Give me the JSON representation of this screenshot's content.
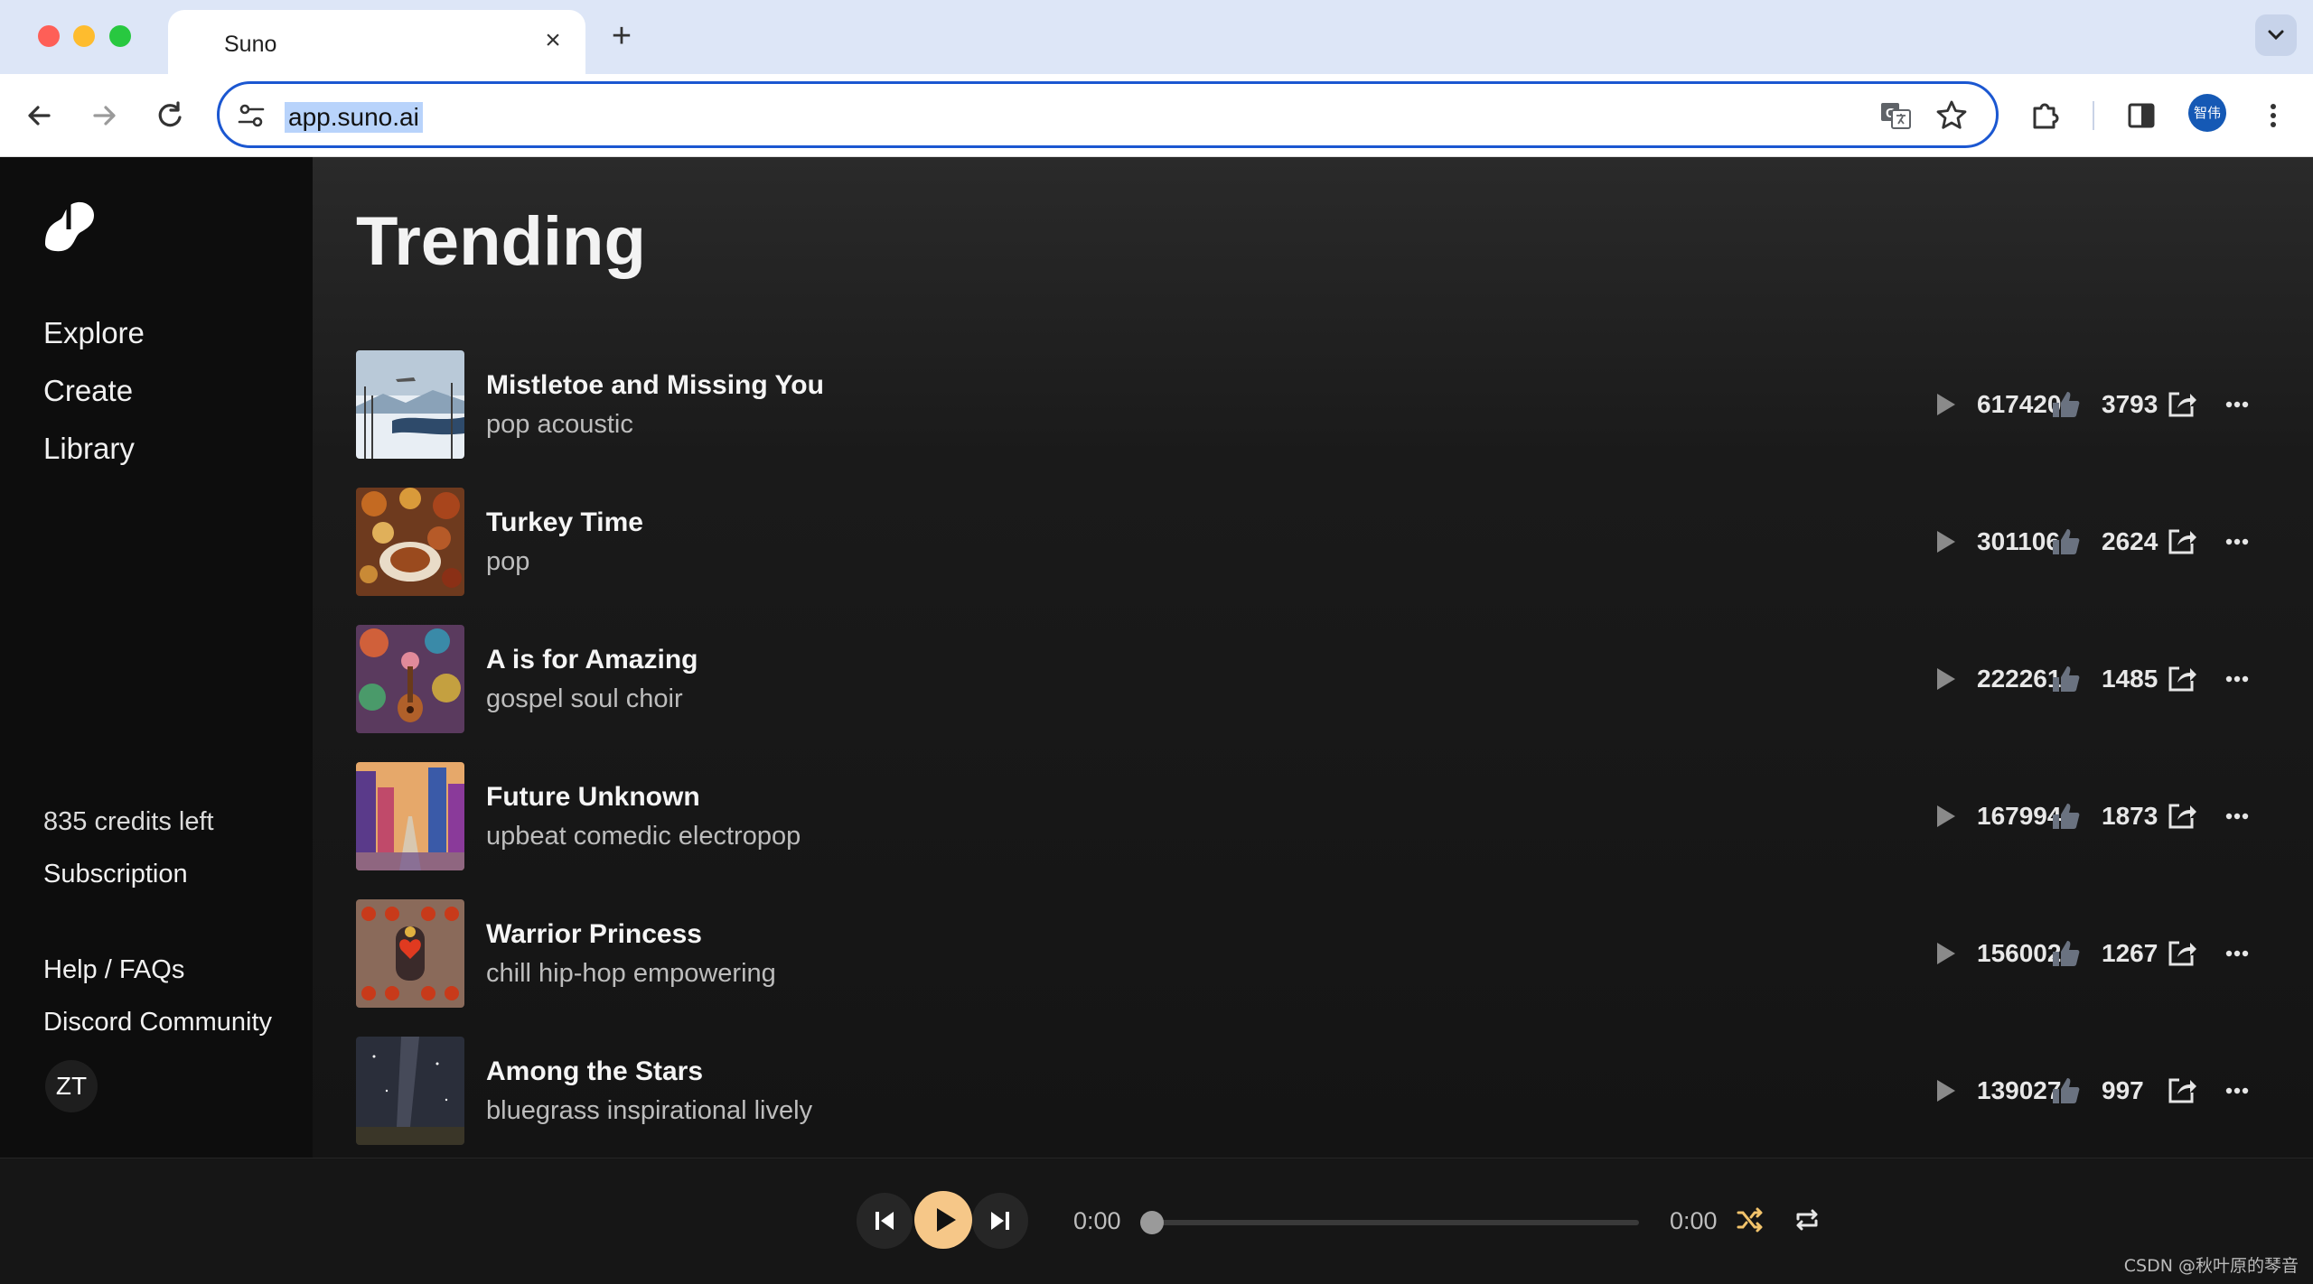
{
  "browser": {
    "tab_title": "Suno",
    "close_label": "×",
    "newtab_label": "+",
    "url": "app.suno.ai",
    "profile_initials": "智伟"
  },
  "sidebar": {
    "nav": [
      "Explore",
      "Create",
      "Library"
    ],
    "credits": "835 credits left",
    "subscription": "Subscription",
    "help": "Help / FAQs",
    "discord": "Discord Community",
    "user_initials": "ZT"
  },
  "main": {
    "title": "Trending",
    "songs": [
      {
        "title": "Mistletoe and Missing You",
        "genre": "pop acoustic",
        "plays": "617420",
        "likes": "3793"
      },
      {
        "title": "Turkey Time",
        "genre": "pop",
        "plays": "301106",
        "likes": "2624"
      },
      {
        "title": "A is for Amazing",
        "genre": "gospel soul choir",
        "plays": "222261",
        "likes": "1485"
      },
      {
        "title": "Future Unknown",
        "genre": "upbeat comedic electropop",
        "plays": "167994",
        "likes": "1873"
      },
      {
        "title": "Warrior Princess",
        "genre": "chill hip-hop empowering",
        "plays": "156002",
        "likes": "1267"
      },
      {
        "title": "Among the Stars",
        "genre": "bluegrass inspirational lively",
        "plays": "139027",
        "likes": "997"
      }
    ]
  },
  "player": {
    "current_time": "0:00",
    "duration": "0:00",
    "progress": 0
  },
  "watermark": "CSDN @秋叶原的琴音",
  "colors": {
    "accent": "#f6c788",
    "shuffle_active": "#f2c36b",
    "background": "#121212",
    "omnibox_border": "#1b57d1"
  }
}
